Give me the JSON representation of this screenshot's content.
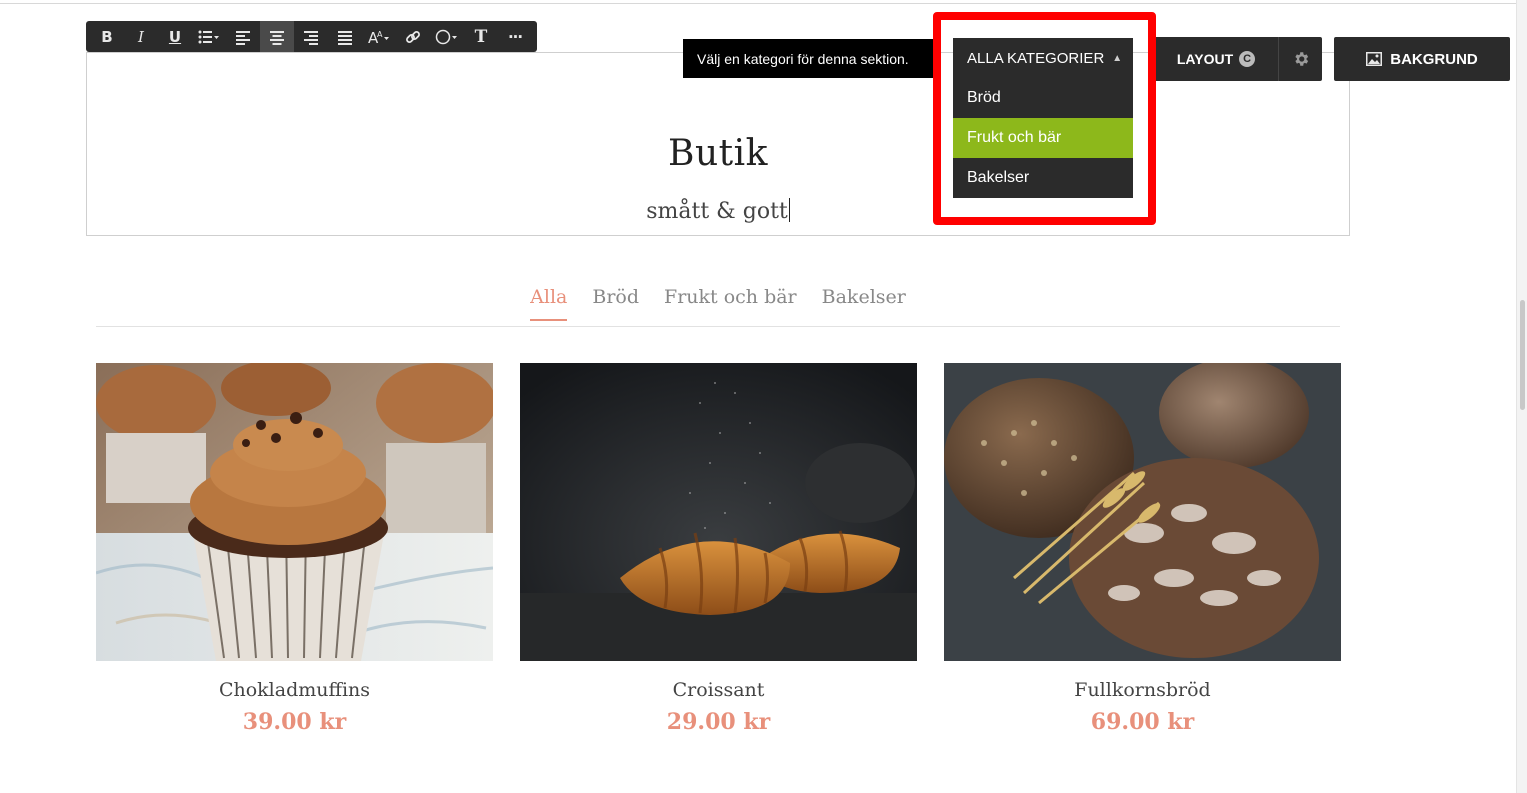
{
  "editor_toolbar": {
    "buttons": [
      {
        "label": "B",
        "icon": "bold-icon"
      },
      {
        "label": "I",
        "icon": "italic-icon"
      },
      {
        "label": "U",
        "icon": "underline-icon"
      },
      {
        "label": "",
        "icon": "bullet-list-icon"
      },
      {
        "label": "",
        "icon": "align-left-icon"
      },
      {
        "label": "",
        "icon": "align-center-icon",
        "active": true
      },
      {
        "label": "",
        "icon": "align-right-icon"
      },
      {
        "label": "",
        "icon": "justify-icon"
      },
      {
        "label": "",
        "icon": "font-size-icon"
      },
      {
        "label": "",
        "icon": "link-icon"
      },
      {
        "label": "",
        "icon": "shape-icon"
      },
      {
        "label": "T",
        "icon": "text-style-icon"
      },
      {
        "label": "···",
        "icon": "more-icon"
      }
    ]
  },
  "section_toolbar": {
    "tooltip": "Välj en kategori för denna sektion.",
    "category_select": {
      "selected_label": "ALLA KATEGORIER",
      "options": [
        "Bröd",
        "Frukt och bär",
        "Bakelser"
      ],
      "highlighted_option": "Frukt och bär"
    },
    "layout_label": "LAYOUT",
    "layout_badge": "C",
    "background_label": "BAKGRUND"
  },
  "header": {
    "title": "Butik",
    "subtitle": "smått & gott"
  },
  "tabs": [
    "Alla",
    "Bröd",
    "Frukt och bär",
    "Bakelser"
  ],
  "active_tab": "Alla",
  "products": [
    {
      "name": "Chokladmuffins",
      "price": "39.00 kr",
      "image": "cupcakes-photo"
    },
    {
      "name": "Croissant",
      "price": "29.00 kr",
      "image": "croissant-photo"
    },
    {
      "name": "Fullkornsbröd",
      "price": "69.00 kr",
      "image": "bread-photo"
    }
  ],
  "colors": {
    "accent": "#e8907b",
    "toolbar": "#2b2b2b",
    "selected_option": "#8db81b",
    "highlight_frame": "#ff0000"
  }
}
